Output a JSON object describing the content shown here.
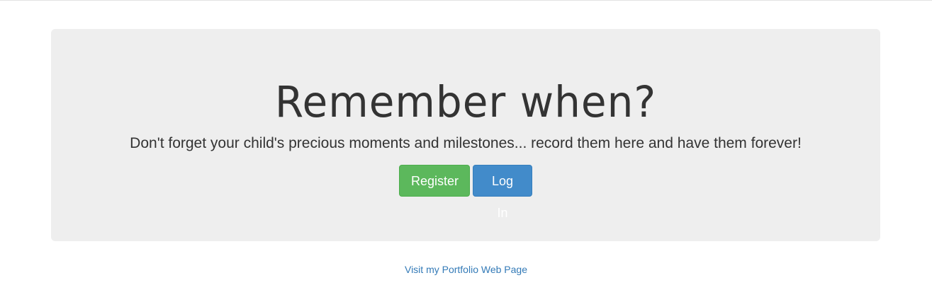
{
  "hero": {
    "title": "Remember when?",
    "tagline": "Don't forget your child's precious moments and milestones... record them here and have them forever!"
  },
  "actions": {
    "register_label": "Register",
    "login_label": "Log In"
  },
  "footer": {
    "portfolio_link": "Visit my Portfolio Web Page"
  },
  "colors": {
    "panel_background": "#eeeeee",
    "register_button": "#5cb85c",
    "login_button": "#428bca",
    "link": "#337ab7",
    "text": "#333333"
  }
}
